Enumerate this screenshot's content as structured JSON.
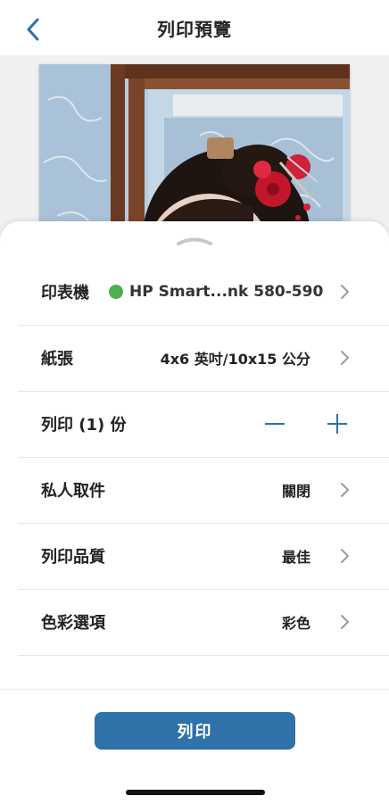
{
  "header": {
    "title": "列印預覽",
    "back_icon": "chevron-left-icon",
    "accent_color": "#2f71a9"
  },
  "preview": {
    "image": "photo-preview"
  },
  "settings": [
    {
      "id": "printer",
      "label": "印表機",
      "value": "HP Smart...nk 580-590",
      "status_color": "#4caf50"
    },
    {
      "id": "paper",
      "label": "紙張",
      "value": "4x6 英吋/10x15 公分"
    },
    {
      "id": "copies",
      "label": "列印 (1) 份"
    },
    {
      "id": "private-pickup",
      "label": "私人取件",
      "value": "關閉"
    },
    {
      "id": "print-quality",
      "label": "列印品質",
      "value": "最佳"
    },
    {
      "id": "color-options",
      "label": "色彩選項",
      "value": "彩色"
    }
  ],
  "footer": {
    "print_label": "列印",
    "button_color": "#2f71a9"
  }
}
